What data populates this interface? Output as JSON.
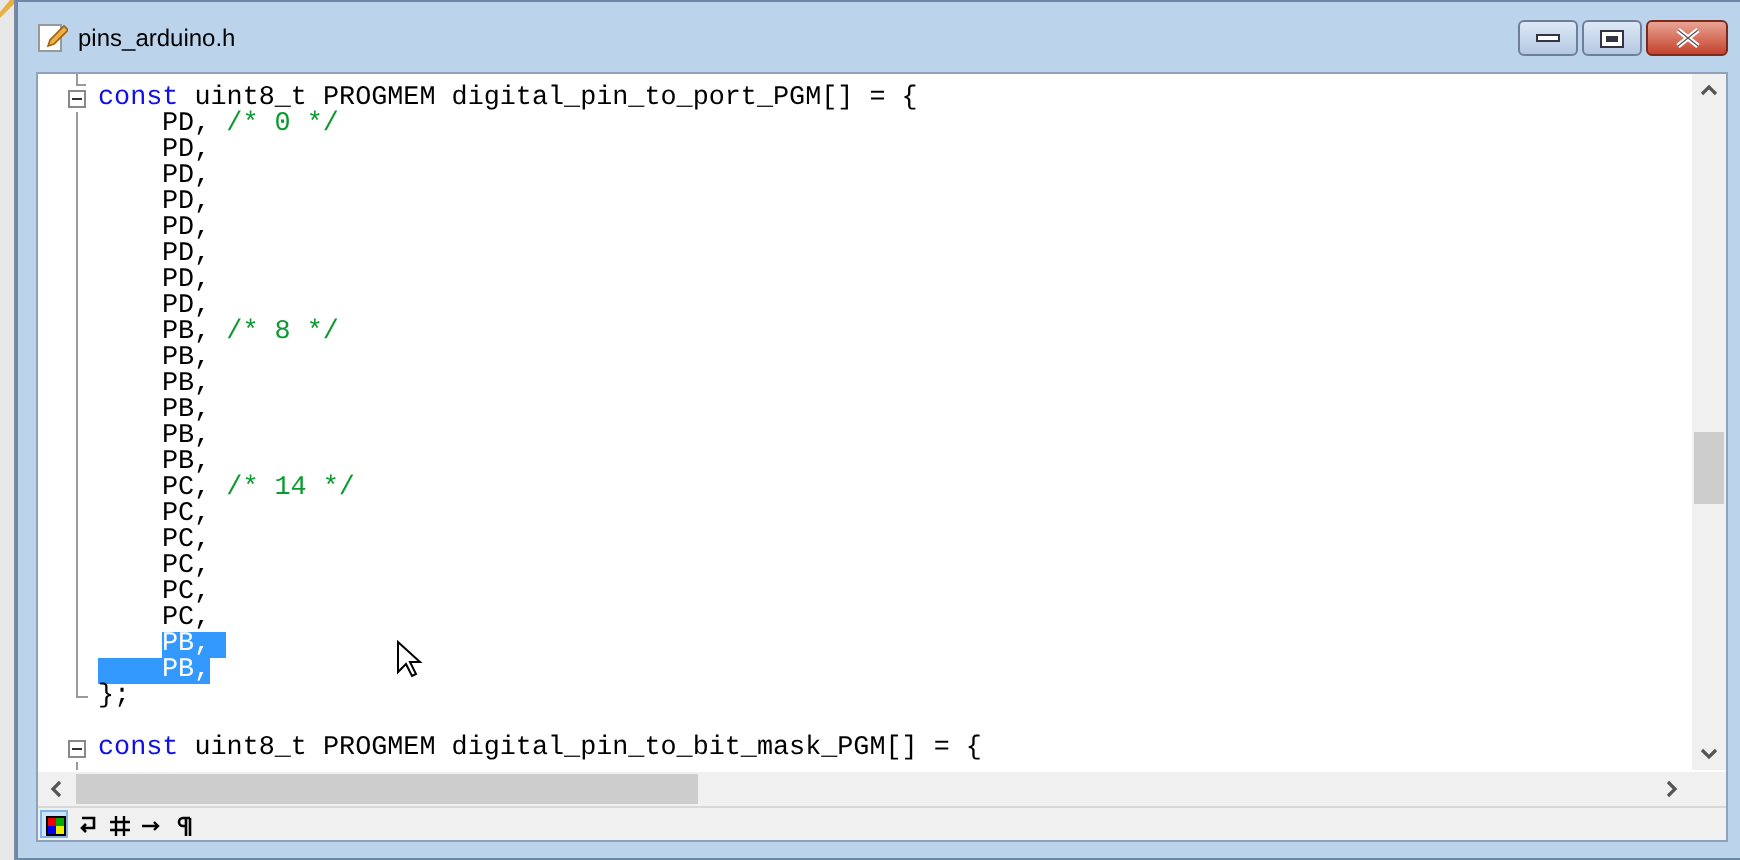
{
  "window": {
    "title": "pins_arduino.h"
  },
  "editor": {
    "lines": [
      {
        "kind": "block",
        "expanded": true,
        "segments": [
          {
            "kind": "keyword",
            "text": "const",
            "selected": false
          },
          {
            "kind": "plain",
            "text": " uint8_t PROGMEM digital_pin_to_port_PGM[] = {",
            "selected": false
          }
        ],
        "children": [
          {
            "kind": "code",
            "selected": false,
            "segments": [
              {
                "kind": "plain",
                "text": "PD, ",
                "selected": false
              },
              {
                "kind": "comment",
                "text": "/* 0 */",
                "selected": false
              }
            ]
          },
          {
            "kind": "code",
            "selected": false,
            "segments": [
              {
                "kind": "plain",
                "text": "PD,",
                "selected": false
              }
            ]
          },
          {
            "kind": "code",
            "selected": false,
            "segments": [
              {
                "kind": "plain",
                "text": "PD,",
                "selected": false
              }
            ]
          },
          {
            "kind": "code",
            "selected": false,
            "segments": [
              {
                "kind": "plain",
                "text": "PD,",
                "selected": false
              }
            ]
          },
          {
            "kind": "code",
            "selected": false,
            "segments": [
              {
                "kind": "plain",
                "text": "PD,",
                "selected": false
              }
            ]
          },
          {
            "kind": "code",
            "selected": false,
            "segments": [
              {
                "kind": "plain",
                "text": "PD,",
                "selected": false
              }
            ]
          },
          {
            "kind": "code",
            "selected": false,
            "segments": [
              {
                "kind": "plain",
                "text": "PD,",
                "selected": false
              }
            ]
          },
          {
            "kind": "code",
            "selected": false,
            "segments": [
              {
                "kind": "plain",
                "text": "PD,",
                "selected": false
              }
            ]
          },
          {
            "kind": "code",
            "selected": false,
            "segments": [
              {
                "kind": "plain",
                "text": "PB, ",
                "selected": false
              },
              {
                "kind": "comment",
                "text": "/* 8 */",
                "selected": false
              }
            ]
          },
          {
            "kind": "code",
            "selected": false,
            "segments": [
              {
                "kind": "plain",
                "text": "PB,",
                "selected": false
              }
            ]
          },
          {
            "kind": "code",
            "selected": false,
            "segments": [
              {
                "kind": "plain",
                "text": "PB,",
                "selected": false
              }
            ]
          },
          {
            "kind": "code",
            "selected": false,
            "segments": [
              {
                "kind": "plain",
                "text": "PB,",
                "selected": false
              }
            ]
          },
          {
            "kind": "code",
            "selected": false,
            "segments": [
              {
                "kind": "plain",
                "text": "PB,",
                "selected": false
              }
            ]
          },
          {
            "kind": "code",
            "selected": false,
            "segments": [
              {
                "kind": "plain",
                "text": "PB,",
                "selected": false
              }
            ]
          },
          {
            "kind": "code",
            "selected": false,
            "segments": [
              {
                "kind": "plain",
                "text": "PC, ",
                "selected": false
              },
              {
                "kind": "comment",
                "text": "/* 14 */",
                "selected": false
              }
            ]
          },
          {
            "kind": "code",
            "selected": false,
            "segments": [
              {
                "kind": "plain",
                "text": "PC,",
                "selected": false
              }
            ]
          },
          {
            "kind": "code",
            "selected": false,
            "segments": [
              {
                "kind": "plain",
                "text": "PC,",
                "selected": false
              }
            ]
          },
          {
            "kind": "code",
            "selected": false,
            "segments": [
              {
                "kind": "plain",
                "text": "PC,",
                "selected": false
              }
            ]
          },
          {
            "kind": "code",
            "selected": false,
            "segments": [
              {
                "kind": "plain",
                "text": "PC,",
                "selected": false
              }
            ]
          },
          {
            "kind": "code",
            "selected": false,
            "segments": [
              {
                "kind": "plain",
                "text": "PC,",
                "selected": false
              }
            ]
          },
          {
            "kind": "code",
            "selected": false,
            "segments": [
              {
                "kind": "plain",
                "text": "PB, ",
                "selected": true
              }
            ]
          },
          {
            "kind": "code",
            "selected": true,
            "segments": [
              {
                "kind": "plain",
                "text": "PB,",
                "selected": true
              }
            ]
          }
        ],
        "footer": [
          {
            "kind": "plain",
            "text": "};",
            "selected": false
          }
        ]
      },
      {
        "kind": "blank"
      },
      {
        "kind": "block",
        "expanded": true,
        "segments": [
          {
            "kind": "keyword",
            "text": "const",
            "selected": false
          },
          {
            "kind": "plain",
            "text": " uint8_t PROGMEM digital_pin_to_bit_mask_PGM[] = {",
            "selected": false
          }
        ]
      }
    ]
  },
  "status_buttons": [
    {
      "kind": "colors",
      "selected": true
    },
    {
      "kind": "wrap",
      "selected": false
    },
    {
      "kind": "grid",
      "selected": false
    },
    {
      "kind": "tab",
      "selected": false
    },
    {
      "kind": "pilcrow",
      "selected": false
    }
  ]
}
